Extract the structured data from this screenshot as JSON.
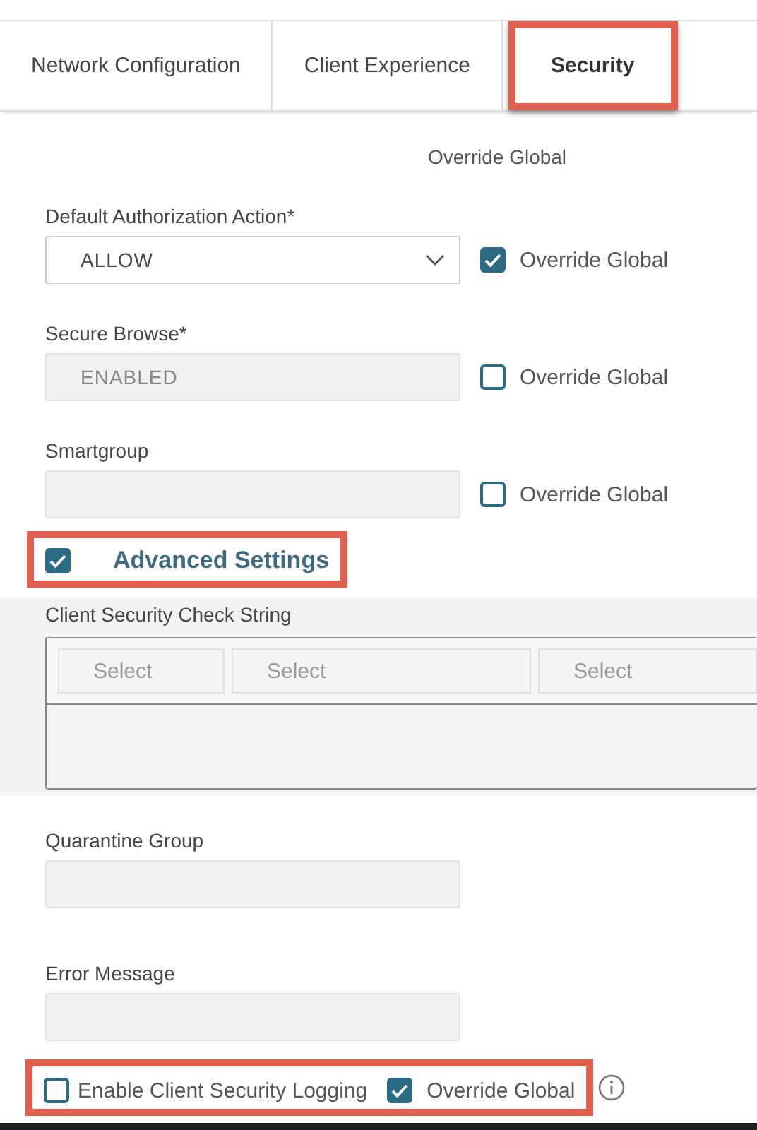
{
  "tabs": [
    {
      "label": "Network Configuration",
      "selected": false,
      "highlighted": false
    },
    {
      "label": "Client Experience",
      "selected": false,
      "highlighted": false
    },
    {
      "label": "Security",
      "selected": true,
      "highlighted": true
    }
  ],
  "override_header": "Override Global",
  "fields": [
    {
      "kind": "select",
      "label": "Default Authorization Action*",
      "value": "ALLOW",
      "disabled": false,
      "override": {
        "label": "Override Global",
        "checked": true
      }
    },
    {
      "kind": "text",
      "label": "Secure Browse*",
      "value": "ENABLED",
      "disabled": true,
      "override": {
        "label": "Override Global",
        "checked": false
      }
    },
    {
      "kind": "text",
      "label": "Smartgroup",
      "disabled": true,
      "override": {
        "label": "Override Global",
        "checked": false
      }
    }
  ],
  "advanced": {
    "label": "Advanced Settings",
    "checked": true,
    "highlighted": true
  },
  "check_string": {
    "label": "Client Security Check String",
    "selects": [
      {
        "placeholder": "Select"
      },
      {
        "placeholder": "Select"
      },
      {
        "placeholder": "Select"
      }
    ]
  },
  "quarantine": {
    "label": "Quarantine Group",
    "disabled": true
  },
  "error_message": {
    "label": "Error Message",
    "disabled": true
  },
  "logging": {
    "label": "Enable Client Security Logging",
    "checked": false,
    "highlighted": true,
    "override": {
      "label": "Override Global",
      "checked": true
    }
  }
}
